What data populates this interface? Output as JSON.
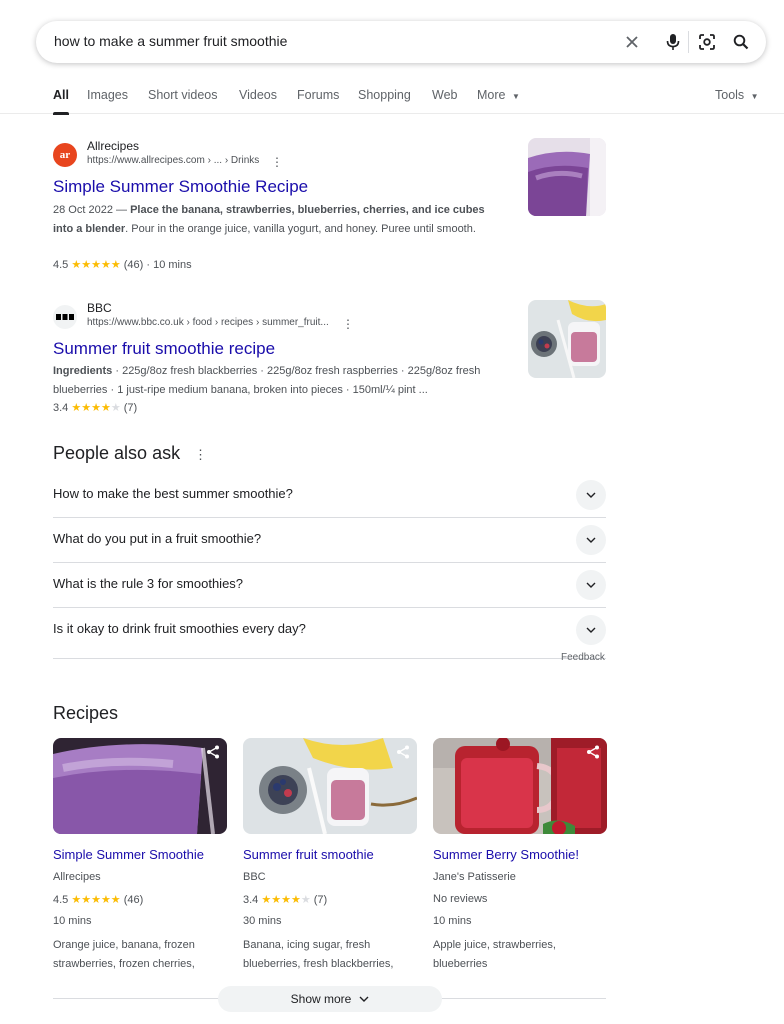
{
  "search": {
    "query": "how to make a summer fruit smoothie"
  },
  "icons": {
    "clear": "close-icon",
    "voice": "microphone-icon",
    "lens": "lens-icon",
    "search": "search-icon"
  },
  "tabs": {
    "all": "All",
    "images": "Images",
    "short_videos": "Short videos",
    "videos": "Videos",
    "forums": "Forums",
    "shopping": "Shopping",
    "web": "Web",
    "more": "More",
    "tools": "Tools"
  },
  "results": [
    {
      "site": "Allrecipes",
      "favicon_text": "ar",
      "url": "https://www.allrecipes.com › ... › Drinks",
      "title": "Simple Summer Smoothie Recipe",
      "date": "28 Oct 2022",
      "snippet_bold": "Place the banana, strawberries, blueberries, cherries, and ice cubes into a blender",
      "snippet_rest": ". Pour in the orange juice, vanilla yogurt, and honey. Puree until smooth.",
      "rating": "4.5",
      "rating_value": 4.5,
      "reviews": "(46)",
      "time": "10 mins"
    },
    {
      "site": "BBC",
      "url": "https://www.bbc.co.uk › food › recipes › summer_fruit...",
      "title": "Summer fruit smoothie recipe",
      "snippet_bold": "Ingredients",
      "snippet_rest": " · 225g/8oz fresh blackberries · 225g/8oz fresh raspberries · 225g/8oz fresh blueberries · 1 just-ripe medium banana, broken into pieces · 150ml/¼ pint ...",
      "rating": "3.4",
      "rating_value": 3.4,
      "reviews": "(7)"
    }
  ],
  "paa": {
    "title": "People also ask",
    "questions": [
      "How to make the best summer smoothie?",
      "What do you put in a fruit smoothie?",
      "What is the rule 3 for smoothies?",
      "Is it okay to drink fruit smoothies every day?"
    ],
    "feedback": "Feedback"
  },
  "recipes": {
    "title": "Recipes",
    "cards": [
      {
        "name": "Simple Summer Smoothie",
        "source": "Allrecipes",
        "rating": "4.5",
        "rating_value": 4.5,
        "reviews": "(46)",
        "time": "10 mins",
        "ingredients": "Orange juice, banana, frozen strawberries, frozen cherries,"
      },
      {
        "name": "Summer fruit smoothie",
        "source": "BBC",
        "rating": "3.4",
        "rating_value": 3.4,
        "reviews": "(7)",
        "time": "30 mins",
        "ingredients": "Banana, icing sugar, fresh blueberries, fresh blackberries,"
      },
      {
        "name": "Summer Berry Smoothie!",
        "source": "Jane's Patisserie",
        "no_reviews": "No reviews",
        "time": "10 mins",
        "ingredients": "Apple juice, strawberries, blueberries"
      }
    ],
    "show_more": "Show more"
  },
  "colors": {
    "link": "#1a0dab",
    "star": "#fbbc04",
    "text_secondary": "#4d5156",
    "allrecipes_brand": "#e8451e"
  }
}
